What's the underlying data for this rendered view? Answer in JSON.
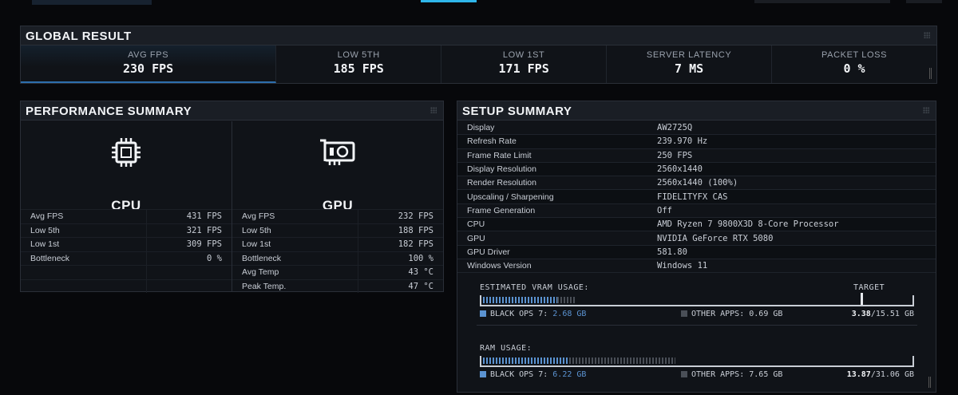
{
  "global": {
    "title": "GLOBAL RESULT",
    "metrics": [
      {
        "label": "AVG FPS",
        "value": "230 FPS"
      },
      {
        "label": "LOW 5TH",
        "value": "185 FPS"
      },
      {
        "label": "LOW 1ST",
        "value": "171 FPS"
      },
      {
        "label": "SERVER LATENCY",
        "value": "7 MS"
      },
      {
        "label": "PACKET LOSS",
        "value": "0 %"
      }
    ]
  },
  "perf": {
    "title": "PERFORMANCE SUMMARY",
    "cpu": {
      "name": "CPU",
      "icon": "cpu-chip-icon",
      "rows": [
        {
          "k": "Avg FPS",
          "v": "431 FPS"
        },
        {
          "k": "Low 5th",
          "v": "321 FPS"
        },
        {
          "k": "Low 1st",
          "v": "309 FPS"
        },
        {
          "k": "Bottleneck",
          "v": "0 %"
        },
        {
          "k": "",
          "v": ""
        },
        {
          "k": "",
          "v": ""
        }
      ]
    },
    "gpu": {
      "name": "GPU",
      "icon": "graphics-card-icon",
      "rows": [
        {
          "k": "Avg FPS",
          "v": "232 FPS"
        },
        {
          "k": "Low 5th",
          "v": "188 FPS"
        },
        {
          "k": "Low 1st",
          "v": "182 FPS"
        },
        {
          "k": "Bottleneck",
          "v": "100 %"
        },
        {
          "k": "Avg Temp",
          "v": "43 °C"
        },
        {
          "k": "Peak Temp.",
          "v": "47 °C"
        }
      ]
    }
  },
  "setup": {
    "title": "SETUP SUMMARY",
    "rows": [
      {
        "k": "Display",
        "v": "AW2725Q"
      },
      {
        "k": "Refresh Rate",
        "v": "239.970 Hz"
      },
      {
        "k": "Frame Rate Limit",
        "v": "250 FPS"
      },
      {
        "k": "Display Resolution",
        "v": "2560x1440"
      },
      {
        "k": "Render Resolution",
        "v": "2560x1440 (100%)"
      },
      {
        "k": "Upscaling / Sharpening",
        "v": "FIDELITYFX CAS"
      },
      {
        "k": "Frame Generation",
        "v": "Off"
      },
      {
        "k": "CPU",
        "v": "AMD Ryzen 7 9800X3D 8-Core Processor"
      },
      {
        "k": "GPU",
        "v": "NVIDIA GeForce RTX 5080"
      },
      {
        "k": "GPU Driver",
        "v": "581.80"
      },
      {
        "k": "Windows Version",
        "v": "Windows 11"
      }
    ],
    "vram": {
      "title": "ESTIMATED VRAM USAGE:",
      "target_label": "TARGET",
      "game_label": "BLACK OPS 7:",
      "game_value": "2.68 GB",
      "other_label": "OTHER APPS:",
      "other_value": "0.69 GB",
      "total_used": "3.38",
      "total_capacity": "/15.51 GB",
      "game_fraction": 0.1728,
      "other_fraction": 0.0445,
      "target_fraction": 0.88
    },
    "ram": {
      "title": "RAM USAGE:",
      "game_label": "BLACK OPS 7:",
      "game_value": "6.22 GB",
      "other_label": "OTHER APPS:",
      "other_value": "7.65 GB",
      "total_used": "13.87",
      "total_capacity": "/31.06 GB",
      "game_fraction": 0.2003,
      "other_fraction": 0.2463
    }
  },
  "colors": {
    "accent": "#2fb6ea",
    "bar_blue": "#5b93d1",
    "bar_other": "#4a4f57"
  }
}
